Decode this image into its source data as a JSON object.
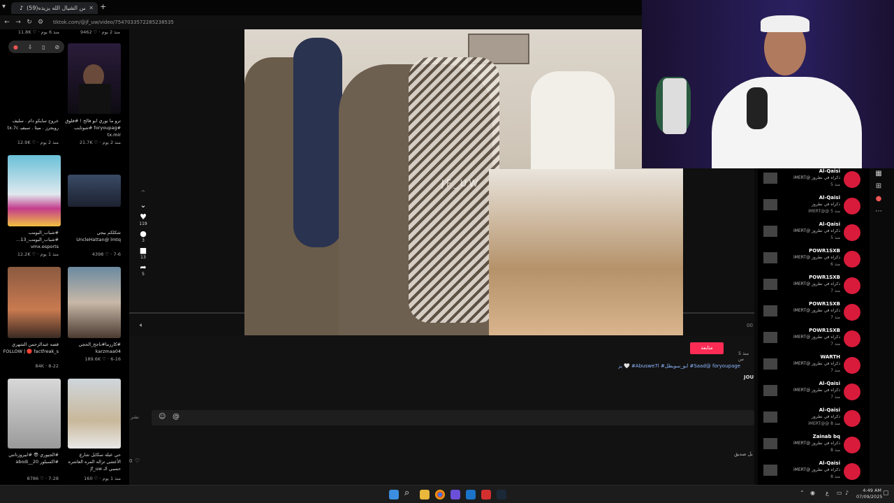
{
  "browser": {
    "tab1_title": "",
    "tab2_title": "(59)والله من الشيال الله يزيده🤍",
    "new_tab": "+",
    "url": "tiktok.com/@jf_uw/video/7547033572285238535"
  },
  "feed": {
    "top_stats": [
      "11.8K ♡ · منذ 6 يوم",
      "9462 ♡ · منذ 2 يوم"
    ],
    "row1": {
      "left_caption": "خروج سايكو دام . سليف روبجرز . ميثا . سيفيـ tx.7c",
      "left_stat": "12.9K ♡ · منذ 2 يوم",
      "right_caption": "ترو ما نوري ابو فالح ! #فلوق #foryoupag #شوتايب tx.mir",
      "right_stat": "21.7K ♡ · منذ 2 يوم"
    },
    "row2": {
      "left_caption": "#شباب_البومب #شباب_البومب_13... vmx.esports",
      "left_stat": "12.2K ♡ · منذ 1 يوم",
      "right_caption": "شكلكم بيجي UncleHattan@ lmtq",
      "right_stat": "4398 ♡ · 7-6"
    },
    "row3": {
      "left_caption": "قصه عبدالرحمن الشهري FOLLOW | 🔴 factfreak_s",
      "left_stat": "84K · 8-22",
      "right_caption": "#كارزما#ناجح_الحجي karzmaa04",
      "right_stat": "189.6K ♡ · 6-16"
    },
    "row4": {
      "left_caption": "#الجيوري 😎 #ابيروزنانتي #اكسبلور abodi__20",
      "left_stat": "8786 ♡ · 7-28",
      "right_caption": "حي عبله سكايل شارع الأعشى تزاله المره العاشره حسبي الـ jf_uw",
      "right_stat": "160 ♡ · منذ 1 يوم"
    }
  },
  "video": {
    "watermark": "JF_UW",
    "likes": "119",
    "comments": "3",
    "saves": "13",
    "shares": "5",
    "time_label": "00"
  },
  "post": {
    "follow_label": "متابعة",
    "posted": "منذ 5 س",
    "hashtags": "Saad@ foryoupage# ابو_سويطل# Abuswe7l# 🤍 يزيده",
    "username_short": "JOU",
    "comment_placeholder": "نشر",
    "likes_count": "0",
    "friend_label": "بل صديق"
  },
  "chat": [
    {
      "name": "Al-Qaisi",
      "line": "ذكراه في نطروز @iMERT",
      "sub": "منذ 5"
    },
    {
      "name": "Al-Qaisi",
      "line": "ذكراه في نطروز",
      "sub": "iMERT@@ منذ 5"
    },
    {
      "name": "Al-Qaisi",
      "line": "ذكراه في نطروز @iMERT",
      "sub": "منذ 5"
    },
    {
      "name": "POWR1SXB",
      "line": "ذكراه في نطروز @iMERT",
      "sub": "منذ 6"
    },
    {
      "name": "POWR1SXB",
      "line": "ذكراه في نطروز @iMERT",
      "sub": "منذ 7"
    },
    {
      "name": "POWR1SXB",
      "line": "ذكراه في نطروز @iMERT",
      "sub": "منذ 7"
    },
    {
      "name": "POWR1SXB",
      "line": "ذكراه في نطروز @iMERT",
      "sub": "منذ 7"
    },
    {
      "name": "WARTH",
      "line": "ذكراه في نطروز @iMERT",
      "sub": "منذ 7"
    },
    {
      "name": "Al-Qaisi",
      "line": "ذكراه في نطروز @iMERT",
      "sub": "منذ 7"
    },
    {
      "name": "Al-Qaisi",
      "line": "ذكراه في نطروز",
      "sub": "iMERT@@ منذ 8"
    },
    {
      "name": "Zainab bq",
      "line": "ذكراه في نطروز @iMERT",
      "sub": "منذ 8"
    },
    {
      "name": "Al-Qaisi",
      "line": "ذكراه في نطروز @iMERT",
      "sub": "منذ 8"
    }
  ],
  "taskbar": {
    "time": "4:49 AM",
    "date": "07/09/2025",
    "lang": "ع"
  },
  "colors": {
    "accent": "#fe2c55",
    "chat_avatar": "#d81b3b",
    "hashtag": "#8fb8ff"
  }
}
